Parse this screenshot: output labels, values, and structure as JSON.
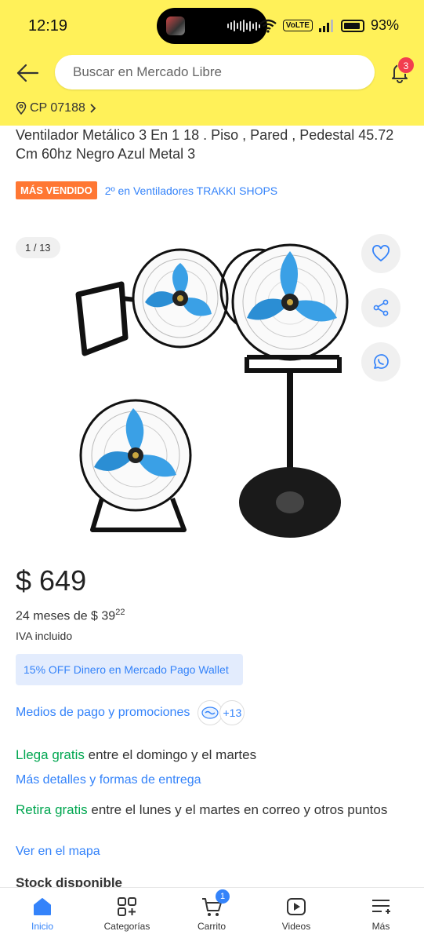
{
  "status_bar": {
    "time": "12:19",
    "battery": "93%",
    "volte": "VoLTE"
  },
  "header": {
    "search_placeholder": "Buscar en Mercado Libre",
    "notifications_count": "3",
    "location": "CP 07188"
  },
  "product": {
    "title": "Ventilador Metálico 3 En 1 18 . Piso , Pared , Pedestal 45.72 Cm 60hz Negro Azul Metal 3",
    "badge": "MÁS VENDIDO",
    "ranking": "2º en Ventiladores TRAKKI SHOPS",
    "image_counter": "1 / 13",
    "price": "$ 649",
    "installments_prefix": "24 meses de $ 39",
    "installments_cents": "22",
    "iva": "IVA incluido",
    "promo": "15% OFF Dinero en Mercado Pago Wallet",
    "payments_link": "Medios de pago y promociones",
    "payments_more": "+13",
    "shipping_highlight": "Llega gratis",
    "shipping_text": " entre el domingo y el martes",
    "shipping_link": "Más detalles y formas de entrega",
    "pickup_highlight": "Retira gratis",
    "pickup_text": " entre el lunes y el martes en correo y otros puntos",
    "map_link": "Ver en el mapa",
    "stock": "Stock disponible"
  },
  "bottom_nav": {
    "items": [
      {
        "label": "Inicio",
        "icon": "home-icon"
      },
      {
        "label": "Categorías",
        "icon": "categories-icon"
      },
      {
        "label": "Carrito",
        "icon": "cart-icon"
      },
      {
        "label": "Videos",
        "icon": "play-icon"
      },
      {
        "label": "Más",
        "icon": "menu-icon"
      }
    ],
    "cart_count": "1"
  },
  "colors": {
    "brand_yellow": "#fff159",
    "link_blue": "#3483fa",
    "green": "#00a650",
    "badge_orange": "#ff7733"
  }
}
